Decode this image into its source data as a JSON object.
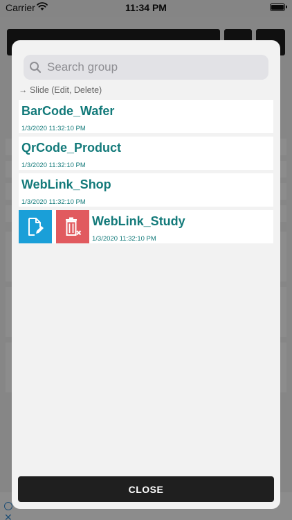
{
  "status_bar": {
    "carrier": "Carrier",
    "time": "11:34 PM"
  },
  "modal": {
    "search": {
      "placeholder": "Search group",
      "value": ""
    },
    "hint": "→ Slide (Edit, Delete)",
    "items": [
      {
        "title": "BarCode_Wafer",
        "date": "1/3/2020 11:32:10 PM"
      },
      {
        "title": "QrCode_Product",
        "date": "1/3/2020 11:32:10 PM"
      },
      {
        "title": "WebLink_Shop",
        "date": "1/3/2020 11:32:10 PM"
      },
      {
        "title": "WebLink_Study",
        "date": "1/3/2020 11:32:10 PM"
      }
    ],
    "close_label": "CLOSE"
  },
  "colors": {
    "accent_teal": "#137a7a",
    "edit_blue": "#1a9fd8",
    "delete_red": "#e15a5f",
    "button_dark": "#1f1f1f"
  },
  "icons": {
    "edit_action": "edit-document-icon",
    "delete_action": "trash-icon",
    "search": "search-icon"
  }
}
